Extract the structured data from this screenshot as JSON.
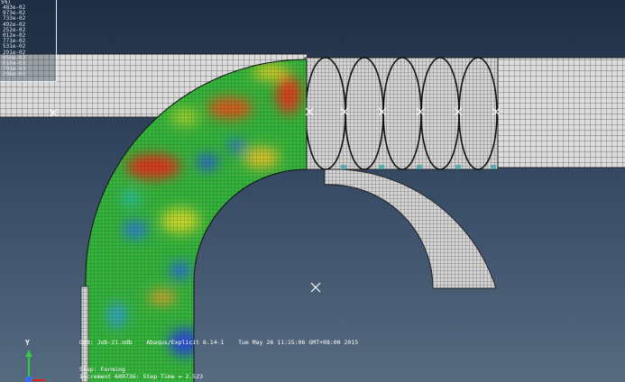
{
  "legend": {
    "title": "5%)",
    "values": [
      "483e-02",
      "973e-02",
      "733e-02",
      "492e-02",
      "252e-02",
      "012e-02",
      "771e-02",
      "531e-02",
      "291e-02",
      "050e-02",
      "010e-03",
      "701e-03",
      "298e-03"
    ]
  },
  "status": {
    "odb": "ODB: Job-21.odb",
    "abaqus": "Abaqus/Explicit 6.14-1",
    "date": "Tue May 26 11:15:06 GMT+08:00 2015",
    "step": "Step: Forming",
    "increment_prefix": "Increment",
    "increment_value": "609736:",
    "step_time_label": "Step Time =",
    "step_time_value": "2.523"
  },
  "triad": {
    "y_label": "Y",
    "x_label": "X"
  },
  "icons": [
    "pick-point-icon"
  ],
  "colors": {
    "bg_top": "#1f2e44",
    "bg_bottom": "#566a80",
    "mesh_grey": "#d9d9d9",
    "contour_green": "#2fb83a",
    "contour_red": "#d83a1c",
    "contour_blue": "#2f5fd0",
    "axis_y": "#2ecc40",
    "axis_x": "#e02020"
  }
}
